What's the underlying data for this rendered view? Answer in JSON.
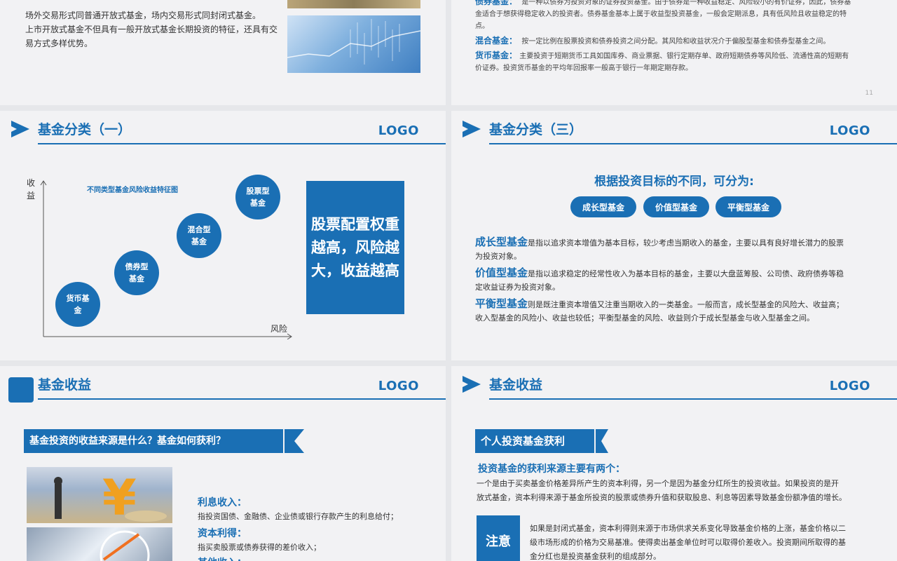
{
  "slide1": {
    "line1": "场外交易形式同普通开放式基金，场内交易形式同封闭式基金。",
    "line2": "上市开放式基金不但具有一般开放式基金长期投资的特征，还具有交",
    "line3": "易方式多样优势。"
  },
  "slide2": {
    "bond_label": "债券基金：",
    "bond_text1": "是一种以债券为投资对象的证券投资基金。由于债券是一种收益稳定、风险较小的有价证券，因此，债券基",
    "bond_text2": "金适合于想获得稳定收入的投资者。债券基金基本上属于收益型投资基金，一般会定期派息，具有低风险且收益稳定的特",
    "bond_text3": "点。",
    "mixed_label": "混合基金：",
    "mixed_text": "按一定比例在股票投资和债券投资之间分配。其风险和收益状况介于偏股型基金和债券型基金之间。",
    "money_label": "货币基金：",
    "money_text1": "主要投资于短期货币工具如国库券、商业票据、银行定期存单、政府短期债券等风险低、流通性高的短期有",
    "money_text2": "价证券。投资货币基金的平均年回报率一般高于银行一年期定期存款。",
    "page_num": "11"
  },
  "slide3": {
    "title": "基金分类（一）",
    "logo": "LOGO",
    "chart_title": "不同类型基金风险收益特征图",
    "y_axis": "收益",
    "x_axis": "风险",
    "circles": [
      "股票型基金",
      "混合型基金",
      "债券型基金",
      "货币基金"
    ],
    "circle_lines": [
      [
        "股票型",
        "基金"
      ],
      [
        "混合型",
        "基金"
      ],
      [
        "债券型",
        "基金"
      ],
      [
        "货币基",
        "金"
      ]
    ],
    "box_lines": [
      "股票配置权重",
      "越高，风险越",
      "大，收益越高"
    ]
  },
  "slide4": {
    "title": "基金分类（三）",
    "logo": "LOGO",
    "heading": "根据投资目标的不同，可分为:",
    "pills": [
      "成长型基金",
      "价值型基金",
      "平衡型基金"
    ],
    "p1_label": "成长型基金",
    "p1_text1": "是指以追求资本增值为基本目标，较少考虑当期收入的基金，主要以具有良好增长潜力的股票",
    "p1_text2": "为投资对象。",
    "p2_label": "价值型基金",
    "p2_text1": "是指以追求稳定的经常性收入为基本目标的基金，主要以大盘蓝筹股、公司债、政府债券等稳",
    "p2_text2": "定收益证券为投资对象。",
    "p3_label": "平衡型基金",
    "p3_text1": "则是既注重资本增值又注重当期收入的一类基金。一般而言，成长型基金的风险大、收益高；",
    "p3_text2": "收入型基金的风险小、收益也较低；平衡型基金的风险、收益则介于成长型基金与收入型基金之间。"
  },
  "slide5": {
    "title": "基金收益",
    "logo": "LOGO",
    "banner": "基金投资的收益来源是什么？基金如何获利？",
    "interest_label": "利息收入：",
    "interest_text": "指投资国债、金融债、企业债或银行存款产生的利息给付；",
    "capital_label": "资本利得：",
    "capital_text": "指买卖股票或债券获得的差价收入；",
    "other_label": "其他收入："
  },
  "slide6": {
    "title": "基金收益",
    "logo": "LOGO",
    "banner": "个人投资基金获利",
    "heading": "投资基金的获利来源主要有两个：",
    "text1": "一个是由于买卖基金价格差异所产生的资本利得，另一个是因为基金分红所生的投资收益。如果投资的是开",
    "text2": "放式基金，资本利得来源于基金所投资的股票或债券升值和获取股息、利息等因素导致基金份额净值的增长。",
    "note_label": "注意",
    "note1": "如果是封闭式基金，资本利得则来源于市场供求关系变化导致基金价格的上涨，基金价格以二",
    "note2": "级市场形成的价格为交易基准。使得卖出基金单位时可以取得价差收入。投资期间所取得的基",
    "note3": "金分红也是投资基金获利的组成部分。"
  },
  "colors": {
    "brand_blue": "#1a6fb4",
    "background": "#f2f2f4"
  }
}
